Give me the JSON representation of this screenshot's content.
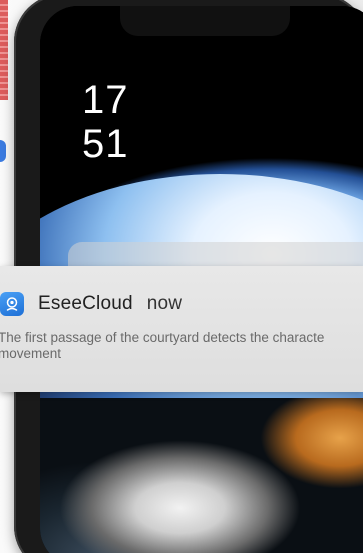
{
  "lockscreen": {
    "clock_hour": "17",
    "clock_minute": "51"
  },
  "notification": {
    "app_name": "EseeCloud",
    "time": "now",
    "message": "The first passage of the courtyard detects the characte\nmovement",
    "icon": "camera-cloud-icon",
    "icon_color": "#2a82e8"
  },
  "colors": {
    "banner_bg": "#e2e2e2",
    "text_primary": "#222222",
    "text_secondary": "#6a6a6a"
  }
}
